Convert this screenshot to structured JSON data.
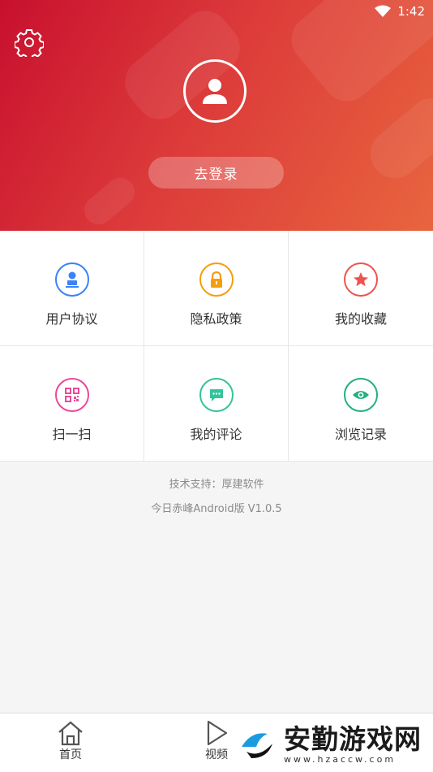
{
  "status_bar": {
    "time": "1:42"
  },
  "header": {
    "login_label": "去登录"
  },
  "grid": {
    "items": [
      {
        "label": "用户协议",
        "icon": "user-agreement-icon",
        "color": "#3b82f6"
      },
      {
        "label": "隐私政策",
        "icon": "lock-icon",
        "color": "#f59e0b"
      },
      {
        "label": "我的收藏",
        "icon": "star-icon",
        "color": "#ef5350"
      },
      {
        "label": "扫一扫",
        "icon": "qr-code-icon",
        "color": "#ec4899"
      },
      {
        "label": "我的评论",
        "icon": "comment-icon",
        "color": "#34c39a"
      },
      {
        "label": "浏览记录",
        "icon": "eye-icon",
        "color": "#22b07d"
      }
    ]
  },
  "footer": {
    "support": "技术支持：厚建软件",
    "version": "今日赤峰Android版 V1.0.5"
  },
  "tabbar": {
    "home": "首页",
    "video": "视频"
  },
  "watermark": {
    "title": "安勤游戏网",
    "url": "www.hzaccw.com"
  }
}
